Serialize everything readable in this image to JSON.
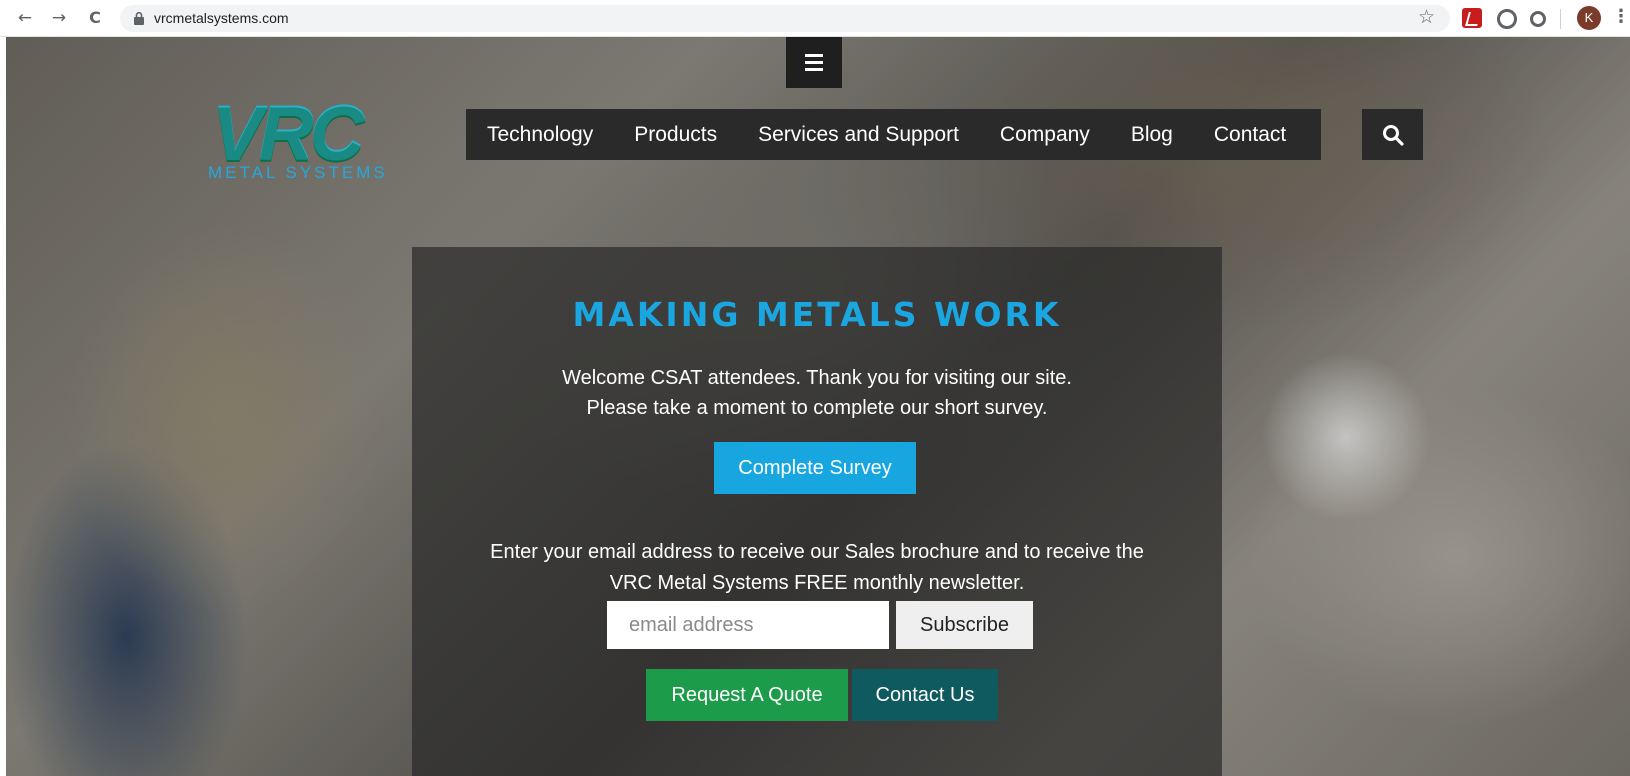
{
  "browser": {
    "url": "vrcmetalsystems.com",
    "back_glyph": "←",
    "forward_glyph": "→",
    "reload_glyph": "C",
    "star_glyph": "☆",
    "profile_initial": "K",
    "menu_glyph": "⋮"
  },
  "logo": {
    "mark": "VRC",
    "subtitle": "METAL SYSTEMS"
  },
  "nav": {
    "items": [
      {
        "label": "Technology"
      },
      {
        "label": "Products"
      },
      {
        "label": "Services and Support"
      },
      {
        "label": "Company"
      },
      {
        "label": "Blog"
      },
      {
        "label": "Contact"
      }
    ]
  },
  "hero": {
    "headline": "MAKING METALS WORK",
    "welcome_line1": "Welcome CSAT attendees. Thank you for visiting our site.",
    "welcome_line2": "Please take a moment to complete our short survey.",
    "survey_button": "Complete Survey",
    "newsletter_line1": "Enter your email address to receive our Sales brochure and to receive the",
    "newsletter_line2": "VRC Metal Systems FREE monthly newsletter.",
    "email_placeholder": "email address",
    "subscribe_button": "Subscribe",
    "quote_button": "Request A Quote",
    "contact_button": "Contact Us"
  },
  "colors": {
    "accent": "#1aa6e0",
    "nav_bg": "#2a2a2a",
    "quote_green": "#1c9b4a",
    "contact_teal": "#0f5a5f"
  }
}
